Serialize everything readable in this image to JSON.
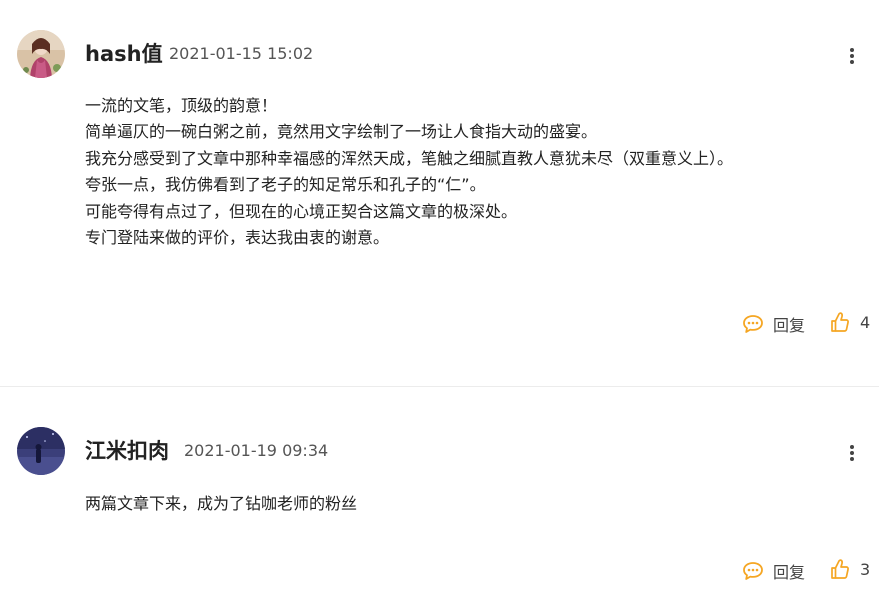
{
  "colors": {
    "accent_icon": "#f5a623",
    "text": "#222222",
    "meta": "#555555",
    "divider": "#ececec"
  },
  "comments": [
    {
      "username": "hash值",
      "timestamp": "2021-01-15 15:02",
      "avatar_icon": "avatar-girl-icon",
      "lines": [
        "一流的文笔，顶级的韵意！",
        "简单逼仄的一碗白粥之前，竟然用文字绘制了一场让人食指大动的盛宴。",
        "我充分感受到了文章中那种幸福感的浑然天成，笔触之细腻直教人意犹未尽（双重意义上）。",
        "夸张一点，我仿佛看到了老子的知足常乐和孔子的“仁”。",
        "可能夸得有点过了，但现在的心境正契合这篇文章的极深处。",
        "专门登陆来做的评价，表达我由衷的谢意。"
      ],
      "reply_label": "回复",
      "like_count": "4"
    },
    {
      "username": "江米扣肉",
      "timestamp": "2021-01-19 09:34",
      "avatar_icon": "avatar-night-icon",
      "lines": [
        "两篇文章下来，成为了钻咖老师的粉丝"
      ],
      "reply_label": "回复",
      "like_count": "3"
    }
  ]
}
